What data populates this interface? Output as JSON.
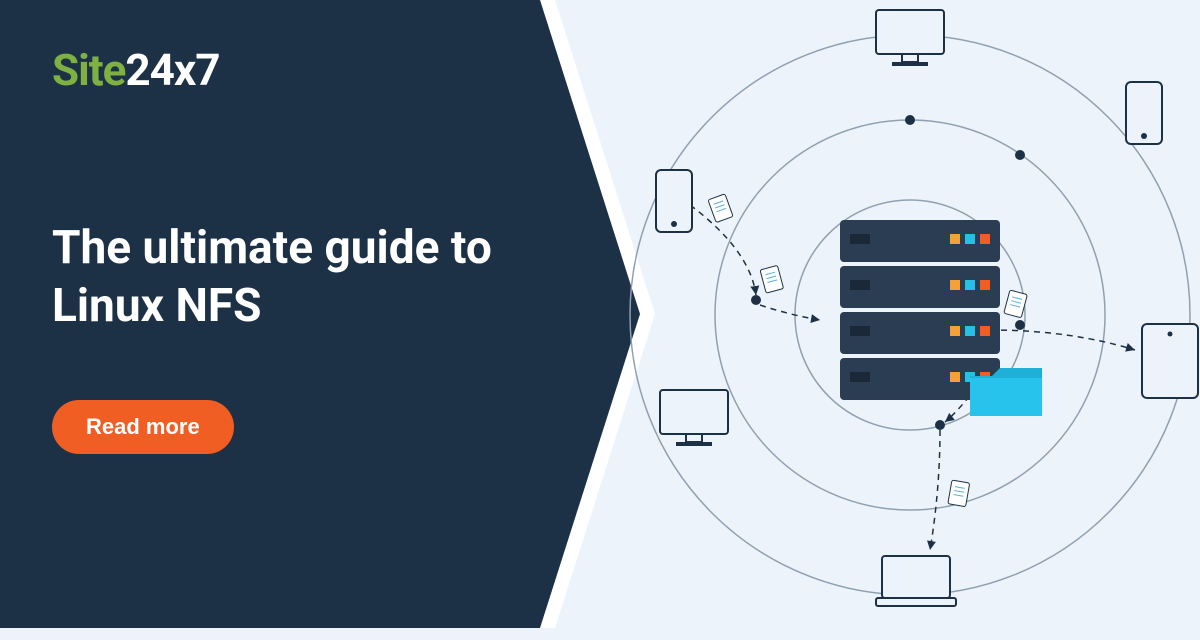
{
  "logo": {
    "part1": "Site",
    "part2": "24x7"
  },
  "headline": "The ultimate guide to Linux NFS",
  "cta": "Read more",
  "colors": {
    "panel": "#1d3146",
    "accent": "#f05e23",
    "logoGreen": "#7fb042",
    "bg": "#ecf3fb"
  }
}
